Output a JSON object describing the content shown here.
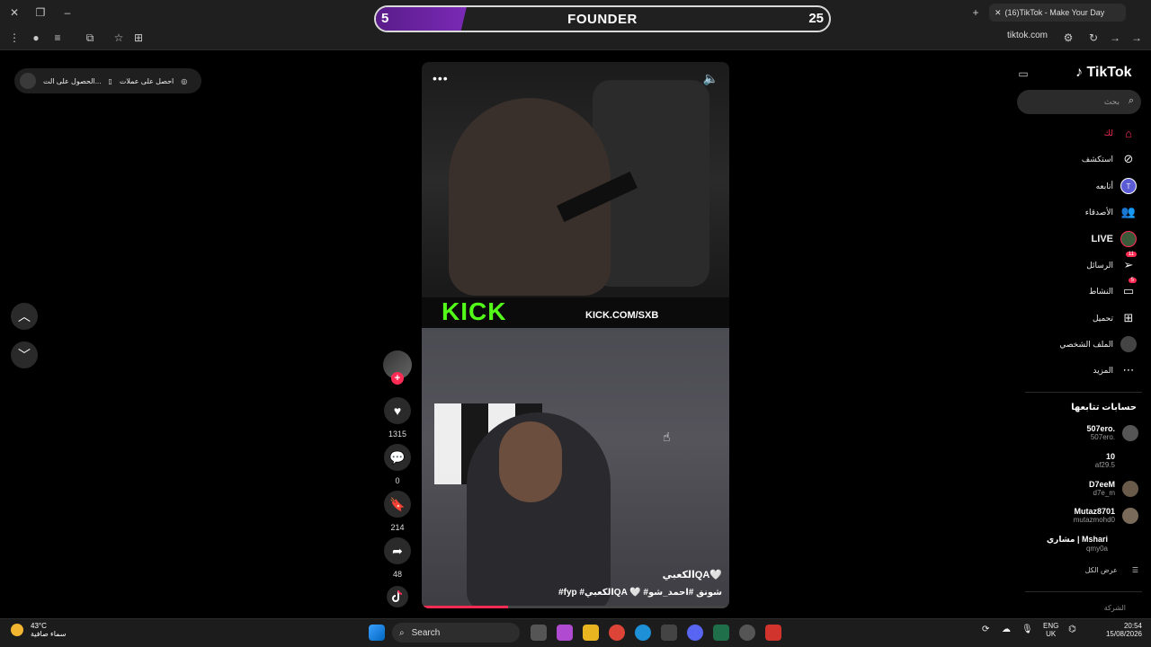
{
  "browser": {
    "tab_title": "(16)TikTok - Make Your Day",
    "url": "tiktok.com"
  },
  "overlay": {
    "left_value": "5",
    "title": "FOUNDER",
    "right_value": "25",
    "progress": 0.2
  },
  "coupon": {
    "label1": "احصل على عملات",
    "label2": "الحصول على الت..."
  },
  "video": {
    "kick_logo": "KICK",
    "kick_url": "KICK.COM/SXB",
    "author": "الكعبيQA🤍",
    "caption": "#fyp #الكعبيQA 🤍 #شونق #احمد_شو",
    "progress": 0.28
  },
  "actions": {
    "likes": "1315",
    "comments": "0",
    "saves": "214",
    "shares": "48"
  },
  "sidebar": {
    "logo": "TikTok",
    "search_placeholder": "بحث",
    "items": [
      {
        "label": "لك",
        "icon": "home-icon"
      },
      {
        "label": "استكشف",
        "icon": "compass-icon"
      },
      {
        "label": "أتابعه",
        "icon": "following-avatar-icon"
      },
      {
        "label": "الأصدقاء",
        "icon": "friends-icon"
      },
      {
        "label": "LIVE",
        "icon": "live-icon"
      },
      {
        "label": "الرسائل",
        "icon": "messages-icon",
        "badge": "11"
      },
      {
        "label": "النشاط",
        "icon": "activity-icon",
        "badge": "5"
      },
      {
        "label": "تحميل",
        "icon": "upload-icon"
      },
      {
        "label": "الملف الشخصي",
        "icon": "profile-icon"
      },
      {
        "label": "المزيد",
        "icon": "more-icon"
      }
    ],
    "following_title": "حسابات تتابعها",
    "accounts": [
      {
        "name": "507ero.",
        "user": "507ero."
      },
      {
        "name": "10",
        "user": "af29.5"
      },
      {
        "name": "D7eeM",
        "user": "d7e_m"
      },
      {
        "name": "Mutaz8701",
        "user": "mutazmohd0"
      },
      {
        "name": "مشاري | Mshari",
        "user": "qmy0a"
      }
    ],
    "show_all": "عرض الكل",
    "company": "الشركة"
  },
  "taskbar": {
    "temperature": "43°C",
    "weather_text": "سماء صافية",
    "search_label": "Search",
    "lang1": "ENG",
    "lang2": "UK",
    "time": "20:54",
    "date": "15/08/2026"
  },
  "colors": {
    "accent": "#fe2c55",
    "kick_green": "#53fc18",
    "overlay_purple": "#7a2ab5"
  }
}
